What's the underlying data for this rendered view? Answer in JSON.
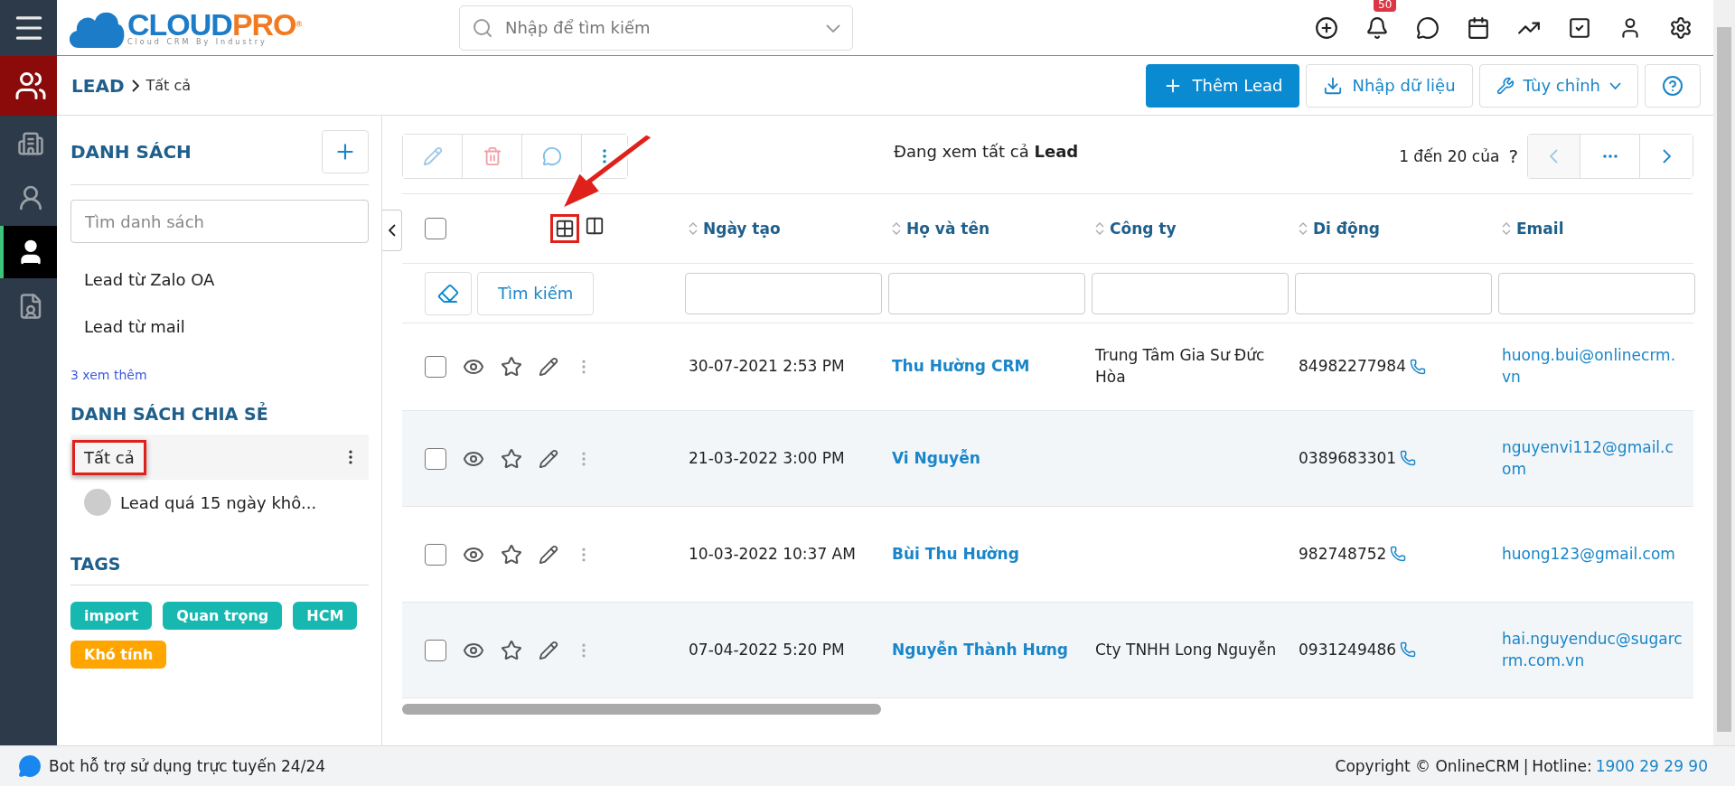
{
  "logo": {
    "primary": "CLOUD",
    "accent": "PRO",
    "mark": "®",
    "tagline": "Cloud CRM By Industry"
  },
  "search": {
    "placeholder": "Nhập để tìm kiếm"
  },
  "notifications": {
    "count": "50"
  },
  "rail": [
    {
      "kind": "users",
      "selected": false,
      "active_module": true
    },
    {
      "kind": "building",
      "selected": false,
      "active_module": false
    },
    {
      "kind": "contact",
      "selected": false,
      "active_module": false
    },
    {
      "kind": "lead",
      "selected": true,
      "active_module": false
    },
    {
      "kind": "document",
      "selected": false,
      "active_module": false
    }
  ],
  "breadcrumb": {
    "module": "LEAD",
    "current": "Tất cả"
  },
  "actions": [
    {
      "kind": "primary",
      "label": "Thêm Lead"
    },
    {
      "kind": "import",
      "label": "Nhập dữ liệu"
    },
    {
      "kind": "customize",
      "label": "Tùy chỉnh"
    },
    {
      "kind": "help"
    }
  ],
  "sidebar": {
    "title": "DANH SÁCH",
    "search_placeholder": "Tìm danh sách",
    "lists": [
      {
        "label": "Lead từ Zalo OA"
      },
      {
        "label": "Lead từ mail"
      }
    ],
    "more": "3 xem thêm",
    "shared_title": "DANH SÁCH CHIA SẺ",
    "shared": [
      {
        "label": "Tất cả",
        "selected": true,
        "annotated": true,
        "owner": false
      },
      {
        "label": "Lead quá 15 ngày khô...",
        "selected": false,
        "annotated": false,
        "owner": true
      }
    ],
    "tags_title": "TAGS",
    "tags": [
      {
        "label": "import",
        "color": "#17b8b0"
      },
      {
        "label": "Quan trọng",
        "color": "#17b8b0"
      },
      {
        "label": "HCM",
        "color": "#17b8b0"
      },
      {
        "label": "Khó tính",
        "color": "#ffa500"
      }
    ]
  },
  "table": {
    "title": "Đang xem tất cả **Lead**",
    "range": "1 đến 20 của",
    "total": "?",
    "layout_toggle": {
      "annotated": true
    },
    "all_checked": false,
    "columns": [
      "Ngày tạo",
      "Họ và tên",
      "Công ty",
      "Di động",
      "Email"
    ],
    "search_button": "Tìm kiếm",
    "rows": [
      {
        "checked": false,
        "date": "30-07-2021 2:53 PM",
        "name": "Thu Hường CRM",
        "company": "Trung Tâm Gia Sư Đức Hòa",
        "phone": "84982277984",
        "email": "huong.bui@onlinecrm.vn"
      },
      {
        "checked": false,
        "date": "21-03-2022 3:00 PM",
        "name": "Vi Nguyễn",
        "company": "",
        "phone": "0389683301",
        "email": "nguyenvi112@gmail.com"
      },
      {
        "checked": false,
        "date": "10-03-2022 10:37 AM",
        "name": "Bùi Thu Hường",
        "company": "",
        "phone": "982748752",
        "email": "huong123@gmail.com"
      },
      {
        "checked": false,
        "date": "07-04-2022 5:20 PM",
        "name": "Nguyễn Thành Hưng",
        "company": "Cty TNHH Long Nguyễn",
        "phone": "0931249486",
        "email": "hai.nguyenduc@sugarcrm.com.vn"
      }
    ]
  },
  "footer": {
    "bot": "Bot hỗ trợ sử dụng trực tuyến 24/24",
    "copyright": "Copyright © OnlineCRM",
    "separator": "|",
    "hotline_label": "Hotline:",
    "hotline": "1900 29 29 90"
  }
}
